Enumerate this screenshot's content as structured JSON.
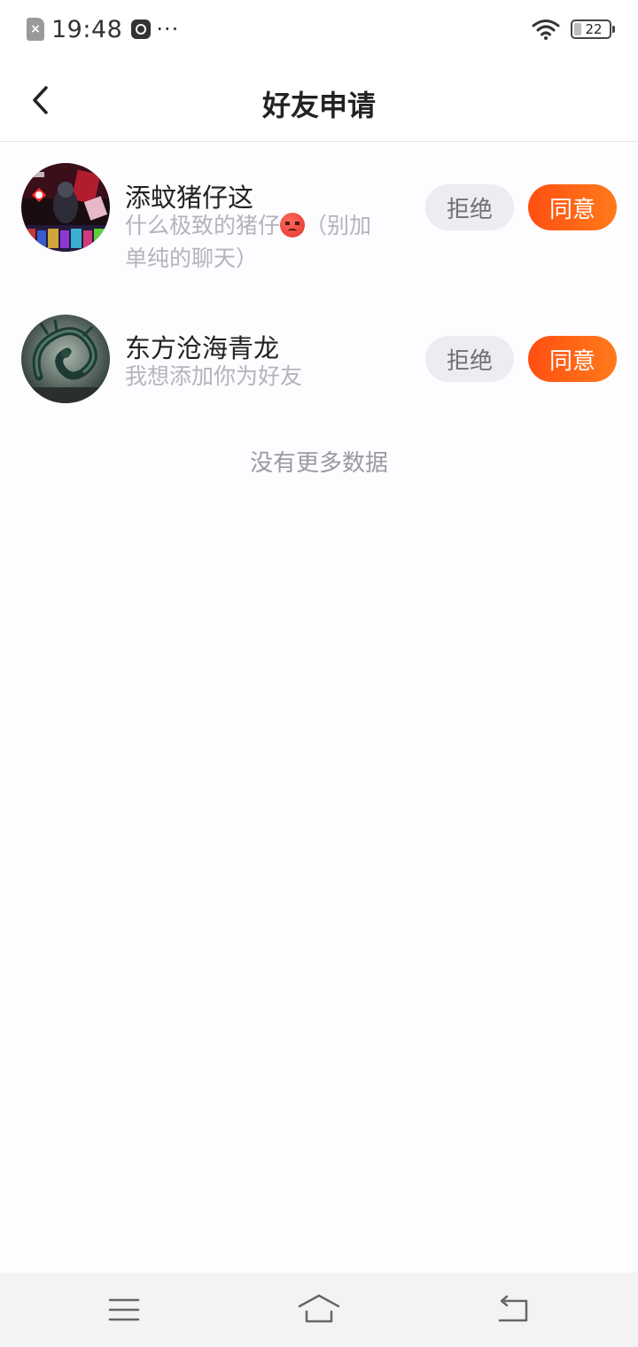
{
  "status_bar": {
    "time": "19:48",
    "sim_icon": "sim-disabled-icon",
    "app_icon": "tiktok-icon",
    "more": "···",
    "battery_level": "22"
  },
  "header": {
    "title": "好友申请",
    "back_icon": "chevron-left-icon"
  },
  "requests": [
    {
      "name": "添蚊猪仔这",
      "message_before": "什么极致的猪仔",
      "message_emoji": "angry-face-emoji",
      "message_after": "（别加单纯的聊天）",
      "reject_label": "拒绝",
      "accept_label": "同意"
    },
    {
      "name": "东方沧海青龙",
      "message_before": "我想添加你为好友",
      "reject_label": "拒绝",
      "accept_label": "同意"
    }
  ],
  "footer_text": "没有更多数据",
  "colors": {
    "accent_start": "#ff4f12",
    "accent_end": "#ff7a1a",
    "reject_bg": "#ecedf2"
  }
}
